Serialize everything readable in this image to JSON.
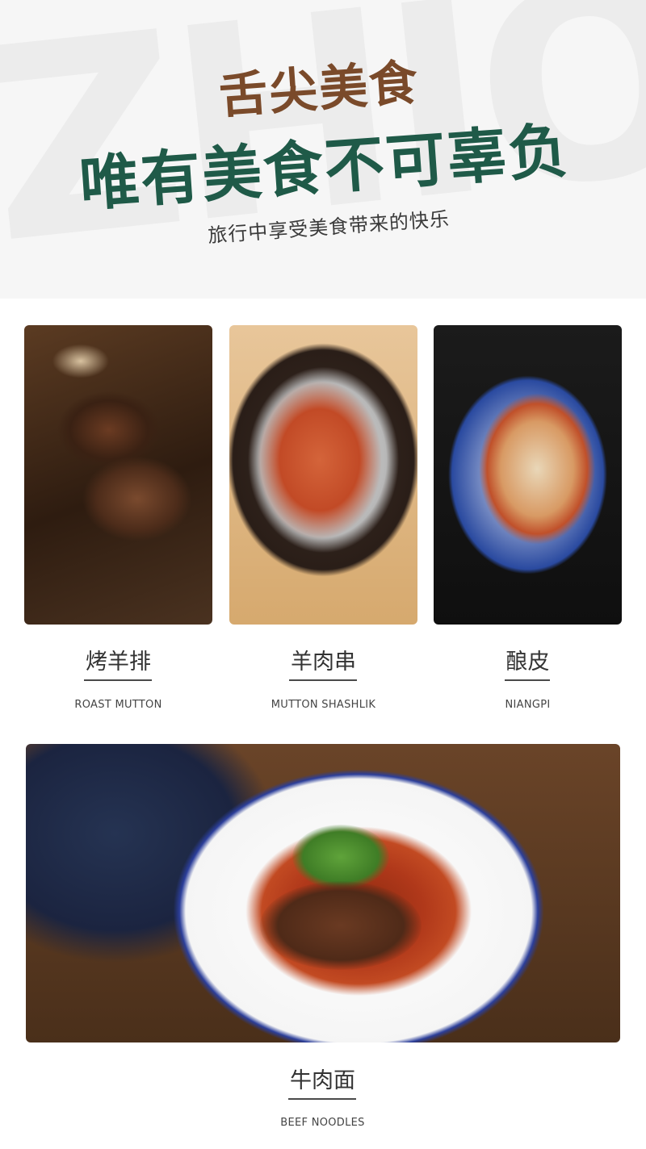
{
  "hero": {
    "watermark": "ZHION",
    "title_line1": "舌尖美食",
    "title_line2": "唯有美食不可辜负",
    "subtitle": "旅行中享受美食带来的快乐"
  },
  "dishes": [
    {
      "name_cn": "烤羊排",
      "name_en": "ROAST MUTTON"
    },
    {
      "name_cn": "羊肉串",
      "name_en": "MUTTON SHASHLIK"
    },
    {
      "name_cn": "酿皮",
      "name_en": "NIANGPI"
    },
    {
      "name_cn": "牛肉面",
      "name_en": "BEEF NOODLES"
    }
  ],
  "colors": {
    "title_brown": "#7a4a2a",
    "title_green": "#1f5a48",
    "text_dark": "#333333"
  }
}
